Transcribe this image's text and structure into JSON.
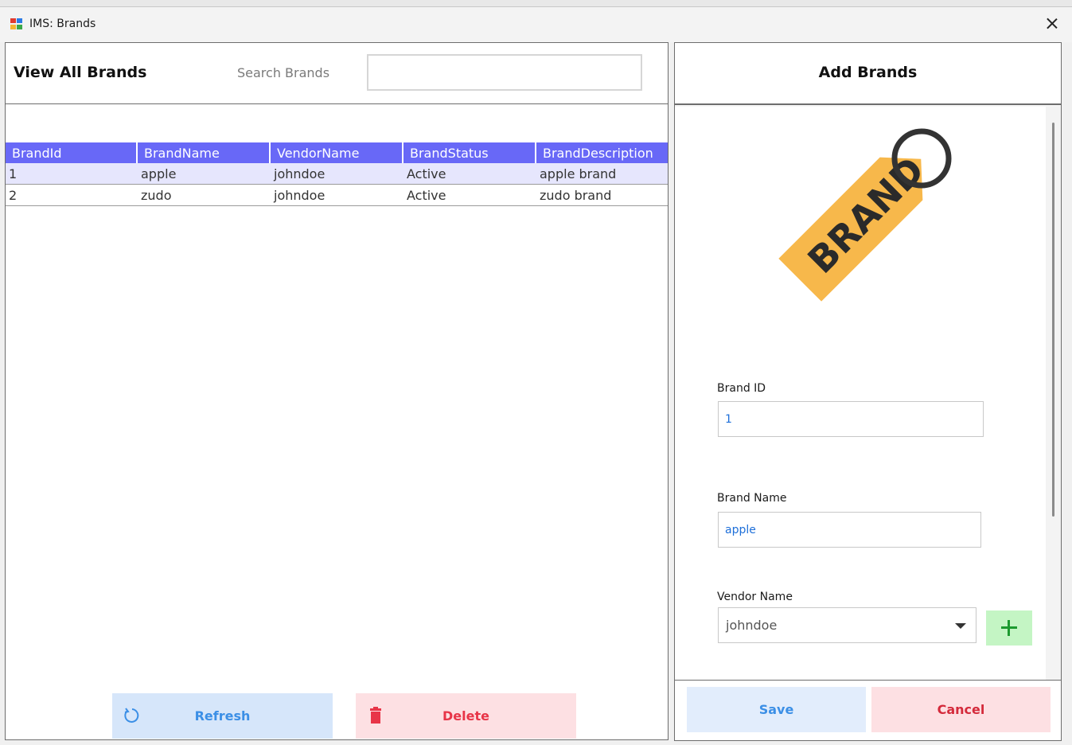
{
  "window": {
    "title": "IMS: Brands"
  },
  "left": {
    "title": "View All Brands",
    "search_label": "Search Brands",
    "search_value": ""
  },
  "grid": {
    "columns": [
      "BrandId",
      "BrandName",
      "VendorName",
      "BrandStatus",
      "BrandDescription"
    ],
    "rows": [
      [
        "1",
        "apple",
        "johndoe",
        "Active",
        "apple brand"
      ],
      [
        "2",
        "zudo",
        "johndoe",
        "Active",
        "zudo brand"
      ]
    ]
  },
  "buttons": {
    "refresh": "Refresh",
    "delete": "Delete",
    "save": "Save",
    "cancel": "Cancel"
  },
  "right": {
    "title": "Add Brands",
    "brand_id_label": "Brand ID",
    "brand_id_value": "1",
    "brand_name_label": "Brand Name",
    "brand_name_value": "apple",
    "vendor_label": "Vendor Name",
    "vendor_value": "johndoe",
    "logo_text": "BRAND"
  },
  "colors": {
    "grid_header": "#6868f7",
    "selected_row": "#e6e6fd",
    "refresh": "#3b8fe6",
    "delete": "#e83548",
    "tag": "#f7b84b"
  }
}
